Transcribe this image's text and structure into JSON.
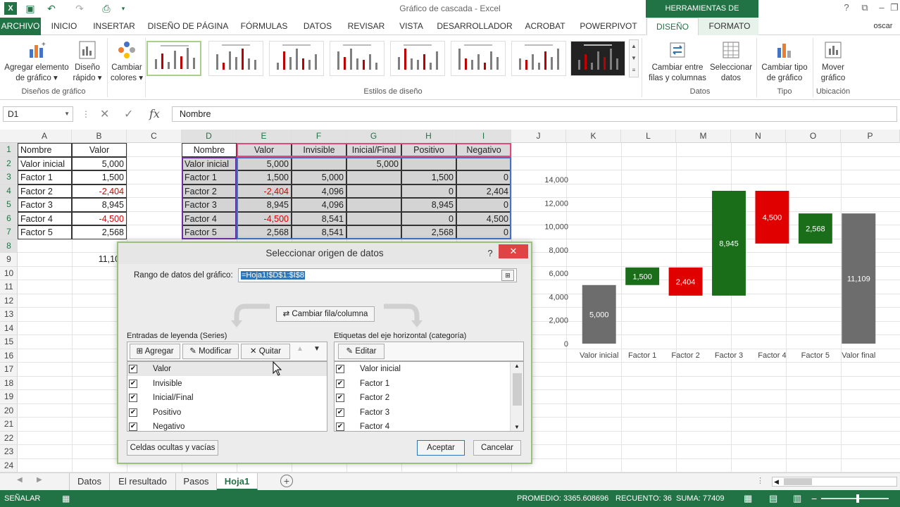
{
  "window": {
    "title": "Gráfico de cascada - Excel",
    "context_header": "HERRAMIENTAS DE GRÁFICOS",
    "user": "oscar"
  },
  "tabs": [
    "ARCHIVO",
    "INICIO",
    "INSERTAR",
    "DISEÑO DE PÁGINA",
    "FÓRMULAS",
    "DATOS",
    "REVISAR",
    "VISTA",
    "DESARROLLADOR",
    "ACROBAT",
    "POWERPIVOT",
    "DISEÑO",
    "FORMATO"
  ],
  "ribbon": {
    "add_element": "Agregar elemento",
    "add_element2": "de gráfico",
    "quick_layout": "Diseño",
    "quick_layout2": "rápido",
    "change_colors": "Cambiar",
    "change_colors2": "colores",
    "group_designs": "Diseños de gráfico",
    "group_styles": "Estilos de diseño",
    "switch_rows": "Cambiar entre",
    "switch_rows2": "filas y columnas",
    "select_data": "Seleccionar",
    "select_data2": "datos",
    "group_data": "Datos",
    "change_type": "Cambiar tipo",
    "change_type2": "de gráfico",
    "group_type": "Tipo",
    "move_chart": "Mover",
    "move_chart2": "gráfico",
    "group_location": "Ubicación"
  },
  "formula_bar": {
    "name_box": "D1",
    "formula": "Nombre",
    "fx": "fx"
  },
  "columns": [
    "A",
    "B",
    "C",
    "D",
    "E",
    "F",
    "G",
    "H",
    "I",
    "J",
    "K",
    "L",
    "M",
    "N",
    "O",
    "P"
  ],
  "rows": [
    "1",
    "2",
    "3",
    "4",
    "5",
    "6",
    "7",
    "8",
    "9",
    "10",
    "11",
    "12",
    "13",
    "14",
    "15",
    "16",
    "17",
    "18",
    "19",
    "20",
    "21",
    "22",
    "23",
    "24"
  ],
  "table1": {
    "header": [
      "Nombre",
      "Valor"
    ],
    "rows": [
      [
        "Valor inicial",
        "5,000"
      ],
      [
        "Factor 1",
        "1,500"
      ],
      [
        "Factor 2",
        "-2,404"
      ],
      [
        "Factor 3",
        "8,945"
      ],
      [
        "Factor 4",
        "-4,500"
      ],
      [
        "Factor 5",
        "2,568"
      ]
    ],
    "total": "11,109"
  },
  "table2": {
    "header": [
      "Nombre",
      "Valor",
      "Invisible",
      "Inicial/Final",
      "Positivo",
      "Negativo"
    ],
    "rows": [
      [
        "Valor inicial",
        "5,000",
        "",
        "5,000",
        "",
        ""
      ],
      [
        "Factor 1",
        "1,500",
        "5,000",
        "",
        "1,500",
        "0"
      ],
      [
        "Factor 2",
        "-2,404",
        "4,096",
        "",
        "0",
        "2,404"
      ],
      [
        "Factor 3",
        "8,945",
        "4,096",
        "",
        "8,945",
        "0"
      ],
      [
        "Factor 4",
        "-4,500",
        "8,541",
        "",
        "0",
        "4,500"
      ],
      [
        "Factor 5",
        "2,568",
        "8,541",
        "",
        "2,568",
        "0"
      ]
    ]
  },
  "chart_data": {
    "type": "bar",
    "subtype": "waterfall",
    "categories": [
      "Valor inicial",
      "Factor 1",
      "Factor 2",
      "Factor 3",
      "Factor 4",
      "Factor 5",
      "Valor final"
    ],
    "invisible": [
      0,
      5000,
      4096,
      4096,
      8541,
      8541,
      0
    ],
    "values": [
      5000,
      1500,
      2404,
      8945,
      4500,
      2568,
      11109
    ],
    "labels": [
      "5,000",
      "1,500",
      "2,404",
      "8,945",
      "4,500",
      "2,568",
      "11,109"
    ],
    "kinds": [
      "total",
      "pos",
      "neg",
      "pos",
      "neg",
      "pos",
      "total"
    ],
    "colors": {
      "total": "#6d6d6d",
      "pos": "#1a6e1a",
      "neg": "#e00000"
    },
    "yticks": [
      "0",
      "2,000",
      "4,000",
      "6,000",
      "8,000",
      "10,000",
      "12,000",
      "14,000"
    ],
    "ylim": [
      0,
      14000
    ],
    "title": "",
    "xlabel": "",
    "ylabel": ""
  },
  "dialog": {
    "title": "Seleccionar origen de datos",
    "help": "?",
    "close": "✕",
    "range_label": "Rango de datos del gráfico:",
    "range_value": "=Hoja1!$D$1:$I$8",
    "switch_btn": "Cambiar fila/columna",
    "series_label": "Entradas de leyenda (Series)",
    "add": "Agregar",
    "edit": "Modificar",
    "remove": "Quitar",
    "series": [
      "Valor",
      "Invisible",
      "Inicial/Final",
      "Positivo",
      "Negativo"
    ],
    "axis_label": "Etiquetas del eje horizontal (categoría)",
    "axis_edit": "Editar",
    "axis_items": [
      "Valor inicial",
      "Factor 1",
      "Factor 2",
      "Factor 3",
      "Factor 4"
    ],
    "hidden_cells": "Celdas ocultas y vacías",
    "ok": "Aceptar",
    "cancel": "Cancelar"
  },
  "sheets": [
    "Datos",
    "El resultado",
    "Pasos",
    "Hoja1"
  ],
  "status": {
    "mode": "SEÑALAR",
    "average": "PROMEDIO: 3365.608696",
    "count": "RECUENTO: 36",
    "sum": "SUMA: 77409"
  }
}
